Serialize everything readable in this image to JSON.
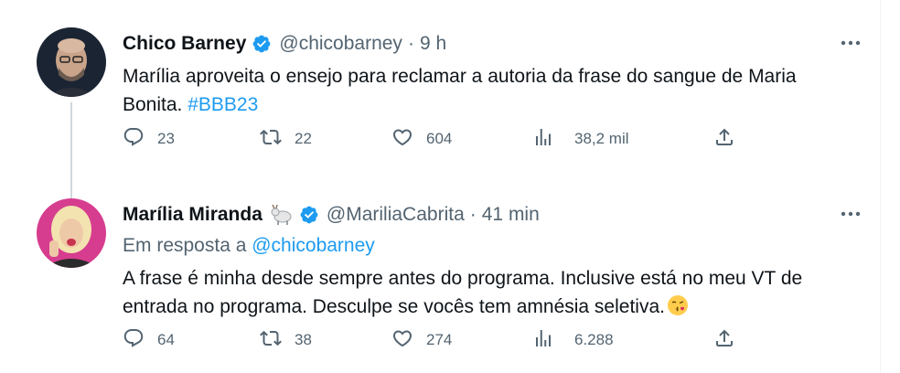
{
  "tweets": [
    {
      "display_name": "Chico Barney",
      "handle": "@chicobarney",
      "separator": "·",
      "time": "9 h",
      "text_main": "Marília aproveita o ensejo para reclamar a autoria da frase do sangue de Maria Bonita. ",
      "hashtag": "#BBB23",
      "replies": "23",
      "retweets": "22",
      "likes": "604",
      "views": "38,2 mil"
    },
    {
      "display_name": "Marília Miranda",
      "handle": "@MariliaCabrita",
      "separator": "·",
      "time": "41 min",
      "reply_prefix": "Em resposta a ",
      "reply_handle": "@chicobarney",
      "text_main": "A frase é minha desde sempre antes do programa. Inclusive está no meu VT de entrada no programa. Desculpe se vocês tem amnésia seletiva.",
      "replies": "64",
      "retweets": "38",
      "likes": "274",
      "views": "6.288"
    }
  ],
  "icons": {
    "verified": "verified-badge-icon",
    "goat": "goat-emoji-icon",
    "kiss": "kiss-emoji-icon",
    "more": "more-options-icon",
    "reply": "reply-icon",
    "retweet": "retweet-icon",
    "like": "heart-icon",
    "views": "views-chart-icon",
    "share": "share-icon"
  },
  "colors": {
    "link": "#1d9bf0",
    "secondary_text": "#536471",
    "primary_text": "#0f1419",
    "thread_line": "#cfd9de"
  }
}
